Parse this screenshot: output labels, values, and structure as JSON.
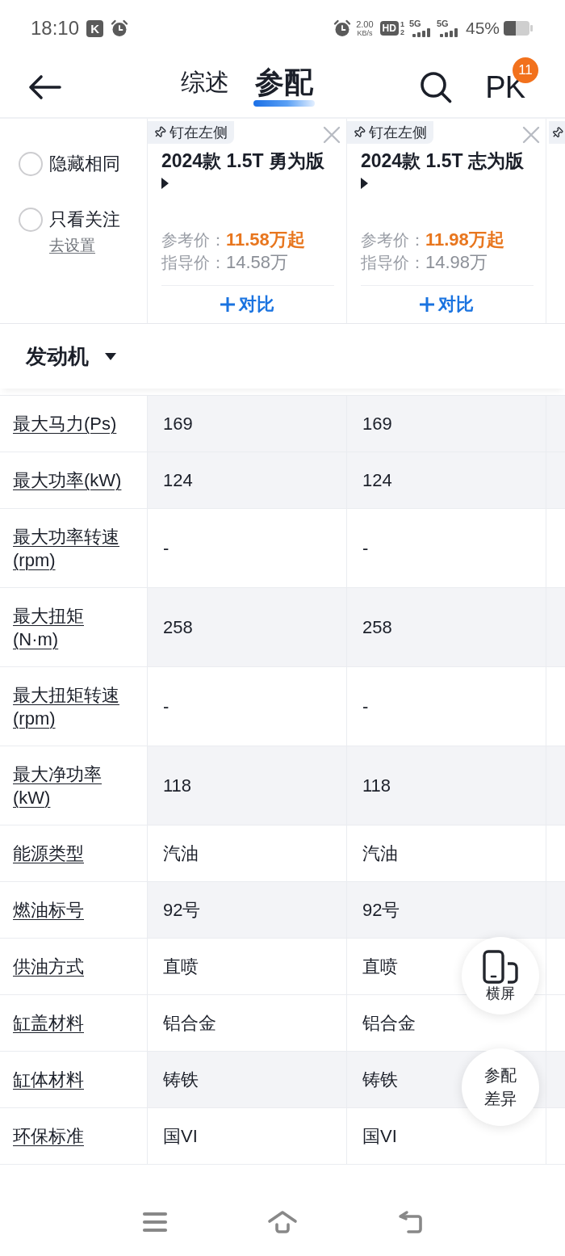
{
  "status_bar": {
    "time": "18:10",
    "app_badge": "K",
    "net_speed": "2.00",
    "net_speed_unit": "KB/s",
    "hd_label": "HD",
    "sim_slots": [
      "1",
      "2"
    ],
    "networks": [
      "5G",
      "5G"
    ],
    "battery": "45%"
  },
  "header": {
    "tabs": [
      {
        "label": "综述",
        "selected": false
      },
      {
        "label": "参配",
        "selected": true
      }
    ],
    "pk": {
      "label": "PK",
      "badge": "11"
    }
  },
  "filters": [
    {
      "label": "隐藏相同",
      "checked": false
    },
    {
      "label": "只看关注",
      "checked": false
    }
  ],
  "settings_link": "去设置",
  "cars": [
    {
      "pin_label": "钉在左侧",
      "name": "2024款 1.5T 勇为版",
      "reference_price_label": "参考价：",
      "reference_price": "11.58万起",
      "guide_price_label": "指导价：",
      "guide_price": "14.58万",
      "compare_label": "对比"
    },
    {
      "pin_label": "钉在左侧",
      "name": "2024款 1.5T 志为版",
      "reference_price_label": "参考价：",
      "reference_price": "11.98万起",
      "guide_price_label": "指导价：",
      "guide_price": "14.98万",
      "compare_label": "对比"
    }
  ],
  "section": {
    "title": "发动机"
  },
  "rows": [
    {
      "label": "最大马力(Ps)",
      "values": [
        "169",
        "169"
      ],
      "shaded": true
    },
    {
      "label": "最大功率(kW)",
      "values": [
        "124",
        "124"
      ],
      "shaded": true
    },
    {
      "label": "最大功率转速(rpm)",
      "values": [
        "-",
        "-"
      ],
      "shaded": false
    },
    {
      "label": "最大扭矩(N·m)",
      "values": [
        "258",
        "258"
      ],
      "shaded": true
    },
    {
      "label": "最大扭矩转速(rpm)",
      "values": [
        "-",
        "-"
      ],
      "shaded": false
    },
    {
      "label": "最大净功率(kW)",
      "values": [
        "118",
        "118"
      ],
      "shaded": true
    },
    {
      "label": "能源类型",
      "values": [
        "汽油",
        "汽油"
      ],
      "shaded": false
    },
    {
      "label": "燃油标号",
      "values": [
        "92号",
        "92号"
      ],
      "shaded": true
    },
    {
      "label": "供油方式",
      "values": [
        "直喷",
        "直喷"
      ],
      "shaded": false
    },
    {
      "label": "缸盖材料",
      "values": [
        "铝合金",
        "铝合金"
      ],
      "shaded": false
    },
    {
      "label": "缸体材料",
      "values": [
        "铸铁",
        "铸铁"
      ],
      "shaded": true
    },
    {
      "label": "环保标准",
      "values": [
        "国VI",
        "国VI"
      ],
      "shaded": false
    }
  ],
  "floating_buttons": [
    {
      "kind": "rotate",
      "label": "横屏"
    },
    {
      "kind": "text",
      "label": "参配差异"
    }
  ]
}
